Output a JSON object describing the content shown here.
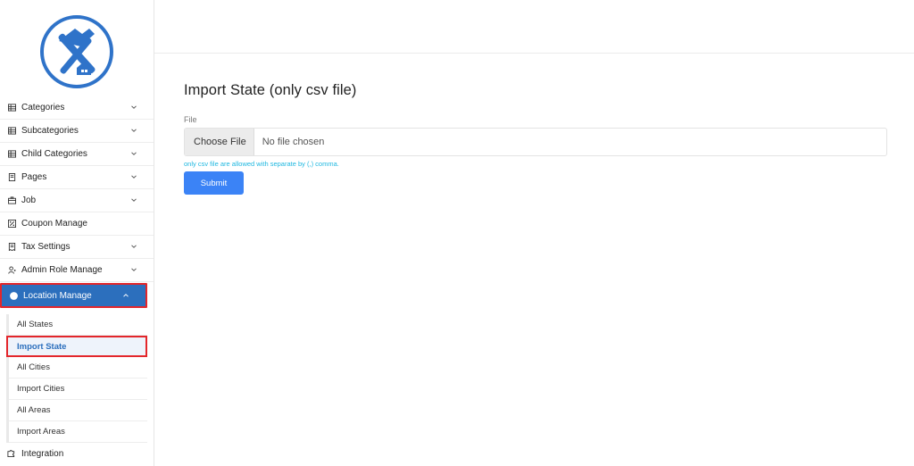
{
  "sidebar": {
    "logo_icon": "hammer-house-icon",
    "items": [
      {
        "label": "Categories",
        "icon": "table-icon",
        "has_chevron": true
      },
      {
        "label": "Subcategories",
        "icon": "table-icon",
        "has_chevron": true
      },
      {
        "label": "Child Categories",
        "icon": "table-icon",
        "has_chevron": true
      },
      {
        "label": "Pages",
        "icon": "page-icon",
        "has_chevron": true
      },
      {
        "label": "Job",
        "icon": "briefcase-icon",
        "has_chevron": true
      },
      {
        "label": "Coupon Manage",
        "icon": "coupon-icon",
        "has_chevron": false
      },
      {
        "label": "Tax Settings",
        "icon": "receipt-icon",
        "has_chevron": true
      },
      {
        "label": "Admin Role Manage",
        "icon": "user-role-icon",
        "has_chevron": true
      },
      {
        "label": "Location Manage",
        "icon": "globe-icon",
        "has_chevron": true,
        "active": true
      }
    ],
    "submenu": [
      {
        "label": "All States"
      },
      {
        "label": "Import State",
        "active": true
      },
      {
        "label": "All Cities"
      },
      {
        "label": "Import Cities"
      },
      {
        "label": "All Areas"
      },
      {
        "label": "Import Areas"
      }
    ],
    "integration": {
      "label": "Integration",
      "icon": "puzzle-icon"
    }
  },
  "main": {
    "title": "Import State (only csv file)",
    "file_label": "File",
    "choose_file_label": "Choose File",
    "file_status": "No file chosen",
    "hint": "only csv file are allowed with separate by (,) comma.",
    "submit_label": "Submit"
  },
  "colors": {
    "accent": "#2c6fbd",
    "highlight_border": "#e3262b",
    "submit": "#3b83f6",
    "hint": "#1fb8e0"
  }
}
